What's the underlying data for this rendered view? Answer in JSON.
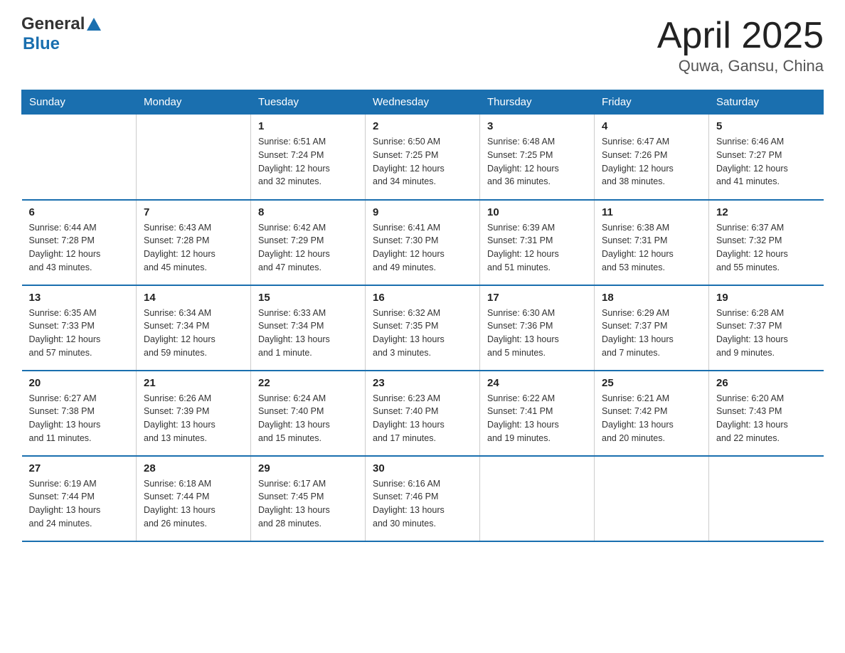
{
  "header": {
    "logo_general": "General",
    "logo_blue": "Blue",
    "month": "April 2025",
    "location": "Quwa, Gansu, China"
  },
  "weekdays": [
    "Sunday",
    "Monday",
    "Tuesday",
    "Wednesday",
    "Thursday",
    "Friday",
    "Saturday"
  ],
  "weeks": [
    [
      {
        "day": "",
        "info": ""
      },
      {
        "day": "",
        "info": ""
      },
      {
        "day": "1",
        "info": "Sunrise: 6:51 AM\nSunset: 7:24 PM\nDaylight: 12 hours\nand 32 minutes."
      },
      {
        "day": "2",
        "info": "Sunrise: 6:50 AM\nSunset: 7:25 PM\nDaylight: 12 hours\nand 34 minutes."
      },
      {
        "day": "3",
        "info": "Sunrise: 6:48 AM\nSunset: 7:25 PM\nDaylight: 12 hours\nand 36 minutes."
      },
      {
        "day": "4",
        "info": "Sunrise: 6:47 AM\nSunset: 7:26 PM\nDaylight: 12 hours\nand 38 minutes."
      },
      {
        "day": "5",
        "info": "Sunrise: 6:46 AM\nSunset: 7:27 PM\nDaylight: 12 hours\nand 41 minutes."
      }
    ],
    [
      {
        "day": "6",
        "info": "Sunrise: 6:44 AM\nSunset: 7:28 PM\nDaylight: 12 hours\nand 43 minutes."
      },
      {
        "day": "7",
        "info": "Sunrise: 6:43 AM\nSunset: 7:28 PM\nDaylight: 12 hours\nand 45 minutes."
      },
      {
        "day": "8",
        "info": "Sunrise: 6:42 AM\nSunset: 7:29 PM\nDaylight: 12 hours\nand 47 minutes."
      },
      {
        "day": "9",
        "info": "Sunrise: 6:41 AM\nSunset: 7:30 PM\nDaylight: 12 hours\nand 49 minutes."
      },
      {
        "day": "10",
        "info": "Sunrise: 6:39 AM\nSunset: 7:31 PM\nDaylight: 12 hours\nand 51 minutes."
      },
      {
        "day": "11",
        "info": "Sunrise: 6:38 AM\nSunset: 7:31 PM\nDaylight: 12 hours\nand 53 minutes."
      },
      {
        "day": "12",
        "info": "Sunrise: 6:37 AM\nSunset: 7:32 PM\nDaylight: 12 hours\nand 55 minutes."
      }
    ],
    [
      {
        "day": "13",
        "info": "Sunrise: 6:35 AM\nSunset: 7:33 PM\nDaylight: 12 hours\nand 57 minutes."
      },
      {
        "day": "14",
        "info": "Sunrise: 6:34 AM\nSunset: 7:34 PM\nDaylight: 12 hours\nand 59 minutes."
      },
      {
        "day": "15",
        "info": "Sunrise: 6:33 AM\nSunset: 7:34 PM\nDaylight: 13 hours\nand 1 minute."
      },
      {
        "day": "16",
        "info": "Sunrise: 6:32 AM\nSunset: 7:35 PM\nDaylight: 13 hours\nand 3 minutes."
      },
      {
        "day": "17",
        "info": "Sunrise: 6:30 AM\nSunset: 7:36 PM\nDaylight: 13 hours\nand 5 minutes."
      },
      {
        "day": "18",
        "info": "Sunrise: 6:29 AM\nSunset: 7:37 PM\nDaylight: 13 hours\nand 7 minutes."
      },
      {
        "day": "19",
        "info": "Sunrise: 6:28 AM\nSunset: 7:37 PM\nDaylight: 13 hours\nand 9 minutes."
      }
    ],
    [
      {
        "day": "20",
        "info": "Sunrise: 6:27 AM\nSunset: 7:38 PM\nDaylight: 13 hours\nand 11 minutes."
      },
      {
        "day": "21",
        "info": "Sunrise: 6:26 AM\nSunset: 7:39 PM\nDaylight: 13 hours\nand 13 minutes."
      },
      {
        "day": "22",
        "info": "Sunrise: 6:24 AM\nSunset: 7:40 PM\nDaylight: 13 hours\nand 15 minutes."
      },
      {
        "day": "23",
        "info": "Sunrise: 6:23 AM\nSunset: 7:40 PM\nDaylight: 13 hours\nand 17 minutes."
      },
      {
        "day": "24",
        "info": "Sunrise: 6:22 AM\nSunset: 7:41 PM\nDaylight: 13 hours\nand 19 minutes."
      },
      {
        "day": "25",
        "info": "Sunrise: 6:21 AM\nSunset: 7:42 PM\nDaylight: 13 hours\nand 20 minutes."
      },
      {
        "day": "26",
        "info": "Sunrise: 6:20 AM\nSunset: 7:43 PM\nDaylight: 13 hours\nand 22 minutes."
      }
    ],
    [
      {
        "day": "27",
        "info": "Sunrise: 6:19 AM\nSunset: 7:44 PM\nDaylight: 13 hours\nand 24 minutes."
      },
      {
        "day": "28",
        "info": "Sunrise: 6:18 AM\nSunset: 7:44 PM\nDaylight: 13 hours\nand 26 minutes."
      },
      {
        "day": "29",
        "info": "Sunrise: 6:17 AM\nSunset: 7:45 PM\nDaylight: 13 hours\nand 28 minutes."
      },
      {
        "day": "30",
        "info": "Sunrise: 6:16 AM\nSunset: 7:46 PM\nDaylight: 13 hours\nand 30 minutes."
      },
      {
        "day": "",
        "info": ""
      },
      {
        "day": "",
        "info": ""
      },
      {
        "day": "",
        "info": ""
      }
    ]
  ]
}
